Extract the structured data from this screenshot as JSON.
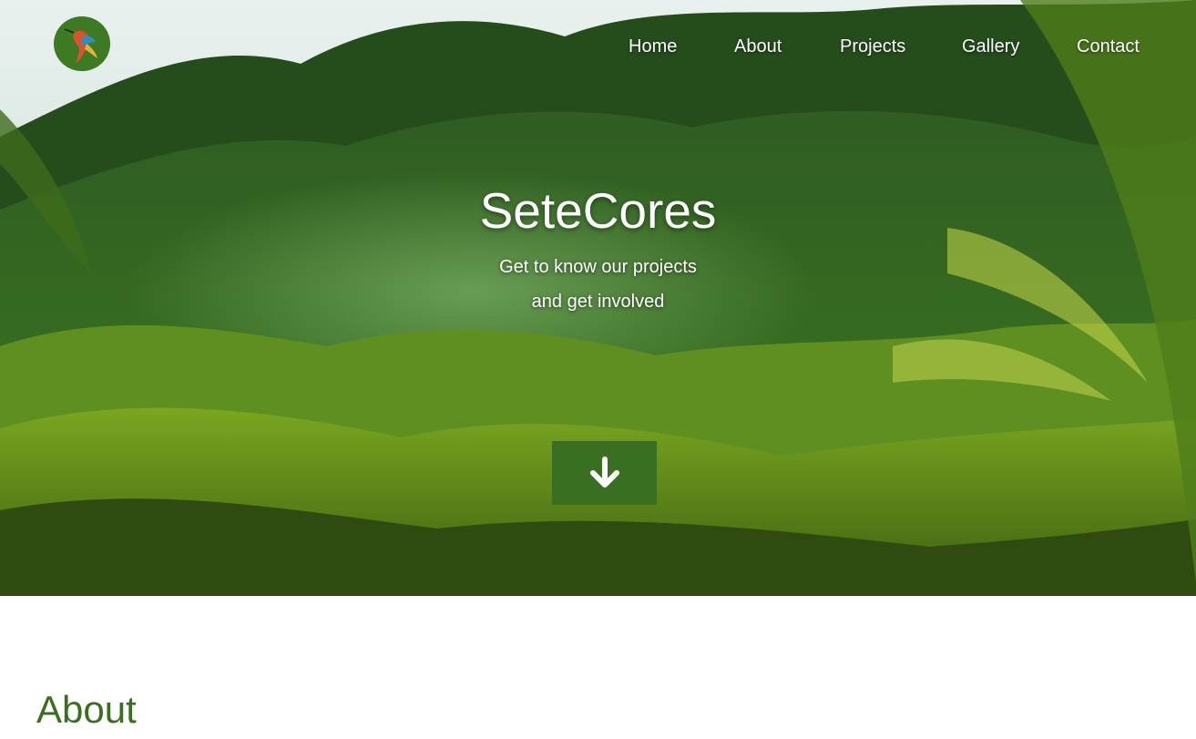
{
  "brand": {
    "logo_icon": "hummingbird-icon",
    "logo_color": "#3e7a24"
  },
  "nav": {
    "items": [
      {
        "label": "Home"
      },
      {
        "label": "About"
      },
      {
        "label": "Projects"
      },
      {
        "label": "Gallery"
      },
      {
        "label": "Contact"
      }
    ]
  },
  "hero": {
    "title": "SeteCores",
    "subtitle_line1": "Get to know our projects",
    "subtitle_line2": "and get involved",
    "scroll_button_icon": "arrow-down-icon",
    "accent_color": "#3a6e21"
  },
  "about": {
    "heading": "About"
  }
}
